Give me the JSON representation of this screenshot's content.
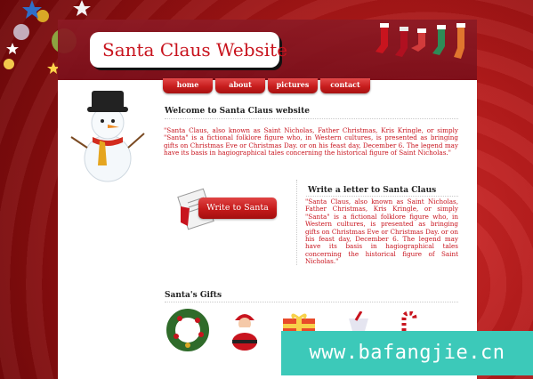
{
  "site": {
    "logo_text": "Santa Claus Website"
  },
  "nav": [
    {
      "label": "home"
    },
    {
      "label": "about"
    },
    {
      "label": "pictures"
    },
    {
      "label": "contact"
    }
  ],
  "welcome": {
    "title": "Welcome to Santa Claus website",
    "text": "\"Santa Claus, also known as Saint Nicholas, Father Christmas, Kris Kringle, or simply \"Santa\" is a fictional folklore figure who, in Western cultures, is presented as bringing gifts on Christmas Eve or Christmas Day. or on his feast day, December 6. The legend may have its basis in hagiographical tales concerning the historical figure of Saint Nicholas.\""
  },
  "letter": {
    "button_label": "Write to Santa",
    "title": "Write a letter to Santa Claus",
    "text": "\"Santa Claus, also known as Saint Nicholas, Father Christmas, Kris Kringle, or simply \"Santa\" is a fictional folklore figure who, in Western cultures, is presented as bringing gifts on Christmas Eve or Christmas Day. or on his feast day, December 6. The legend may have its basis in hagiographical tales concerning the historical figure of Saint Nicholas.\""
  },
  "gifts": {
    "title": "Santa's Gifts",
    "items": [
      "wreath-icon",
      "santa-figure-icon",
      "gift-box-icon",
      "candy-cup-icon",
      "candy-cane-icon"
    ]
  },
  "watermark": "www.bafangjie.cn",
  "colors": {
    "accent": "#c8141e",
    "background": "#a81616",
    "watermark": "#3cc9b9"
  }
}
